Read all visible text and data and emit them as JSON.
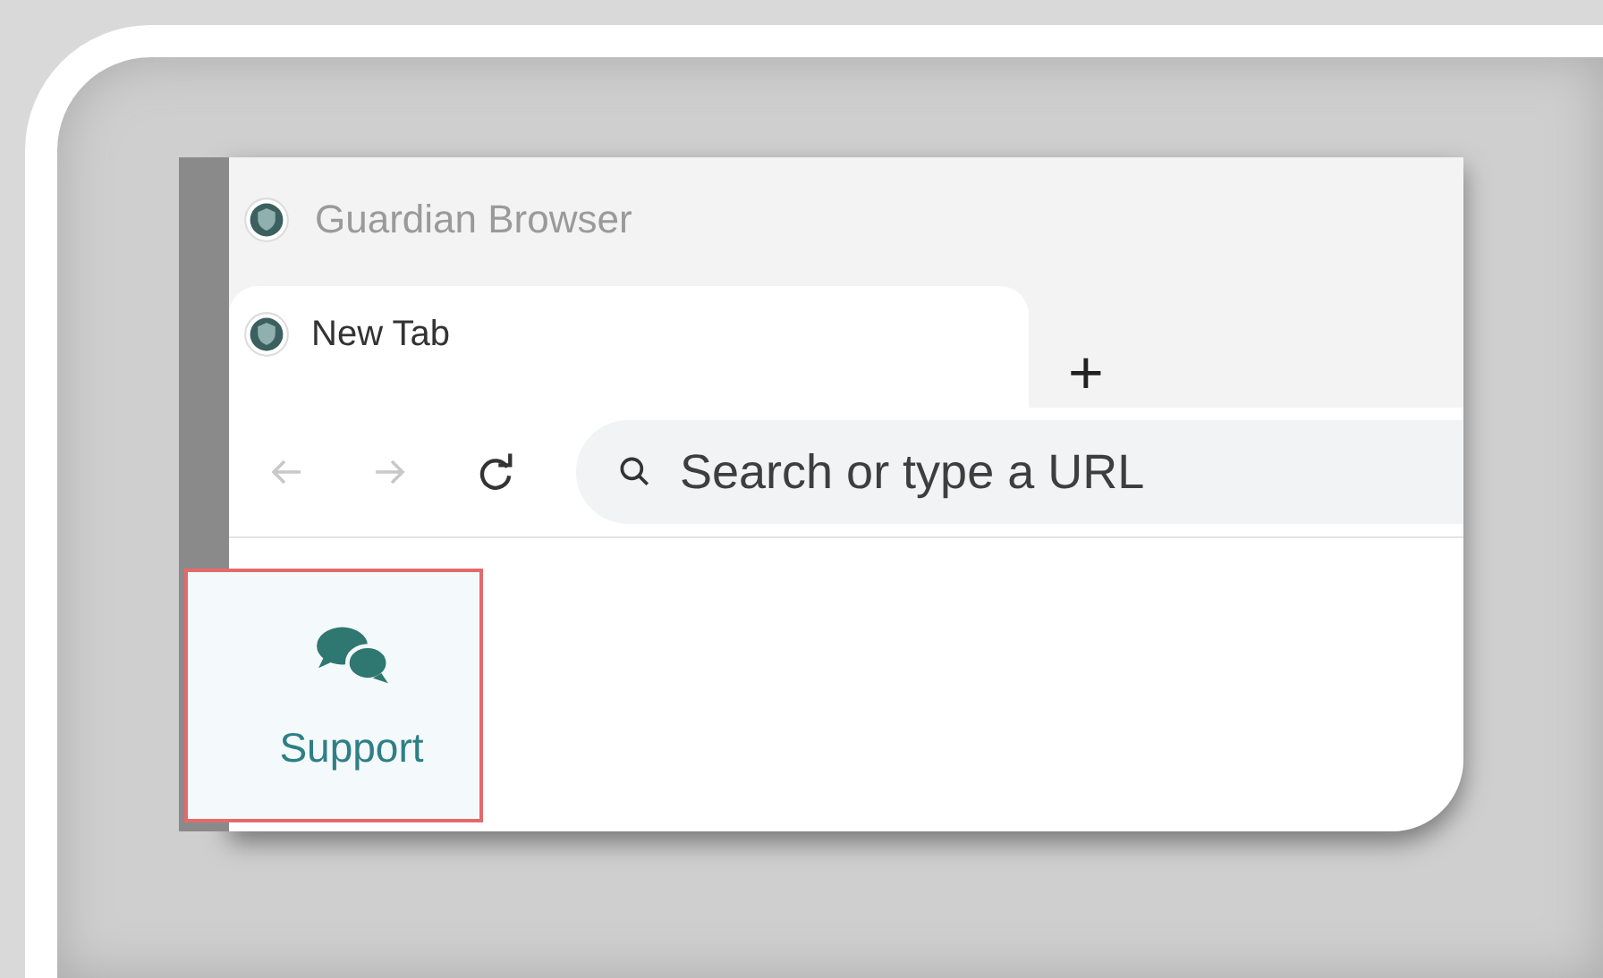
{
  "window": {
    "title": "Guardian Browser"
  },
  "tabs": [
    {
      "label": "New Tab",
      "selected": true
    }
  ],
  "new_tab_button": {
    "label": "+"
  },
  "nav_buttons": [
    {
      "kind": "back",
      "disabled": true
    },
    {
      "kind": "forward",
      "disabled": true
    },
    {
      "kind": "reload",
      "disabled": false
    }
  ],
  "address_bar": {
    "placeholder": "Search or type a URL"
  },
  "sidebar": {
    "items": [
      {
        "label": "Support",
        "highlighted": true
      }
    ]
  }
}
